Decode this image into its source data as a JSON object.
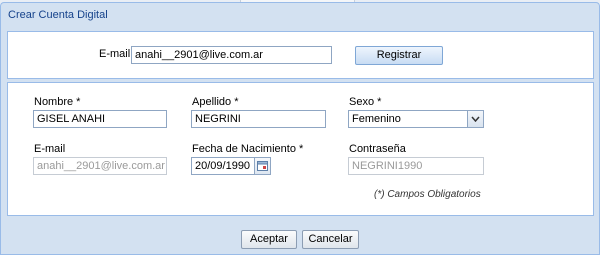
{
  "window": {
    "title": "Crear Cuenta Digital"
  },
  "registro": {
    "email_label": "E-mail:",
    "email_value": "anahi__2901@live.com.ar",
    "register_button": "Registrar"
  },
  "form": {
    "nombre_label": "Nombre *",
    "nombre_value": "GISEL ANAHI",
    "apellido_label": "Apellido *",
    "apellido_value": "NEGRINI",
    "sexo_label": "Sexo *",
    "sexo_value": "Femenino",
    "email_label": "E-mail",
    "email_value": "anahi__2901@live.com.ar",
    "fecha_label": "Fecha de Nacimiento *",
    "fecha_value": "20/09/1990",
    "contrasena_label": "Contraseña",
    "contrasena_value": "NEGRINI1990",
    "required_note": "(*) Campos Obligatorios"
  },
  "footer": {
    "accept_button": "Aceptar",
    "cancel_button": "Cancelar"
  }
}
